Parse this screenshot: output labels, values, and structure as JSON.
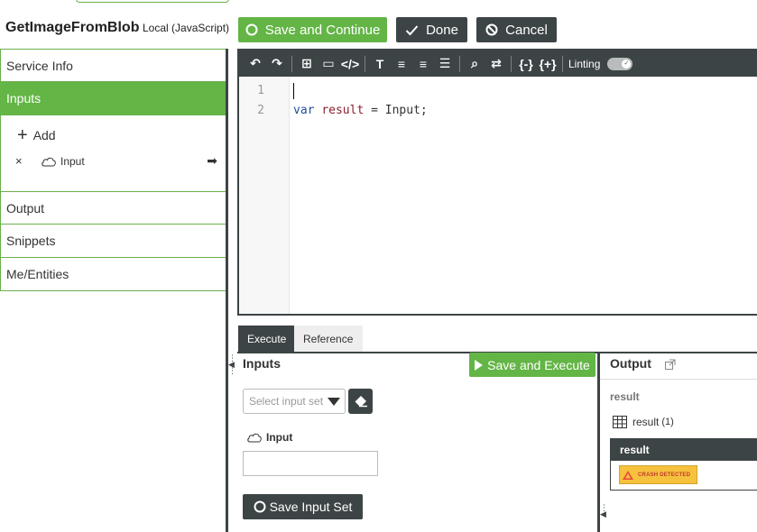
{
  "header": {
    "title": "GetImageFromBlob",
    "subtitle": "Local (JavaScript)",
    "save_continue_label": "Save and Continue",
    "done_label": "Done",
    "cancel_label": "Cancel",
    "accent_color": "#63b546",
    "dark_color": "#3d4446"
  },
  "sidebar": {
    "items": [
      {
        "label": "Service Info"
      },
      {
        "label": "Inputs",
        "active": true
      },
      {
        "label": "Output"
      },
      {
        "label": "Snippets"
      },
      {
        "label": "Me/Entities"
      }
    ],
    "inputs_panel": {
      "add_label": "Add",
      "input_name": "Input"
    }
  },
  "editor": {
    "toolbar": {
      "icons": [
        "undo-icon",
        "redo-icon",
        "add-comment-icon",
        "comment-icon",
        "code-icon",
        "font-size-icon",
        "align-left-icon",
        "align-right-icon",
        "justify-icon",
        "search-icon",
        "replace-icon",
        "collapse-icon",
        "expand-icon"
      ],
      "linting_label": "Linting",
      "linting_on": true
    },
    "lines": [
      {
        "number": "1",
        "text": ""
      },
      {
        "number": "2",
        "keyword": "var",
        "variable": "result",
        "rest": " = Input;"
      }
    ]
  },
  "bottom_tabs": {
    "execute_label": "Execute",
    "reference_label": "Reference"
  },
  "inputs_pane": {
    "title": "Inputs",
    "save_execute_label": "Save and Execute",
    "select_placeholder": "Select input set",
    "input_label": "Input",
    "input_value": "",
    "save_input_set_label": "Save Input Set"
  },
  "output_pane": {
    "title": "Output",
    "section_label": "result",
    "result_row_label": "result",
    "result_count": "(1)",
    "result_header": "result",
    "crash_label": "CRASH DETECTED"
  }
}
